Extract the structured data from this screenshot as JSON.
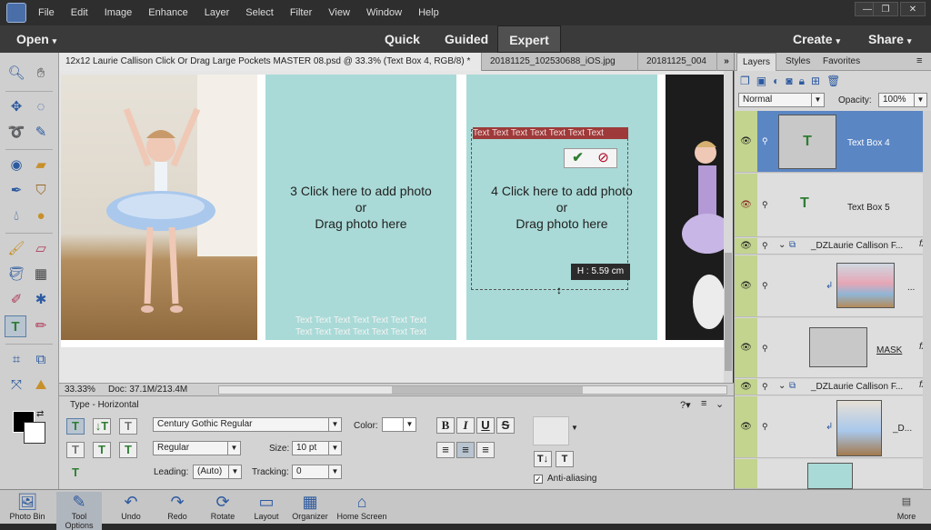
{
  "menu": [
    "File",
    "Edit",
    "Image",
    "Enhance",
    "Layer",
    "Select",
    "Filter",
    "View",
    "Window",
    "Help"
  ],
  "window_buttons": [
    "—",
    "❐",
    "✕"
  ],
  "modes": {
    "open": "Open",
    "quick": "Quick",
    "guided": "Guided",
    "expert": "Expert",
    "create": "Create",
    "share": "Share"
  },
  "tabs": [
    "12x12 Laurie Callison Click Or Drag Large Pockets MASTER 08.psd @ 33.3% (Text Box 4, RGB/8) *",
    "20181125_102530688_iOS.jpg",
    "20181125_004"
  ],
  "canvas": {
    "panel3": {
      "line1": "3 Click here to add photo",
      "line2": "or",
      "line3": "Drag photo here"
    },
    "panel4": {
      "line1": "4 Click here to add photo",
      "line2": "or",
      "line3": "Drag photo here"
    },
    "textbox_text": "Text Text Text Text Text Text Text",
    "footer_text1": "Text Text Text Text Text Text Text",
    "footer_text2": "Text Text Text Text Text Text Text",
    "height_badge": "H : 5.59 cm"
  },
  "status": {
    "zoom": "33.33%",
    "doc": "Doc: 37.1M/213.4M"
  },
  "options": {
    "title": "Type - Horizontal",
    "font": "Century Gothic Regular",
    "style": "Regular",
    "size_label": "Size:",
    "size": "10 pt",
    "leading_label": "Leading:",
    "leading": "(Auto)",
    "tracking_label": "Tracking:",
    "tracking": "0",
    "color_label": "Color:",
    "bold": "B",
    "italic": "I",
    "underline": "U",
    "strike": "S",
    "antialias": "Anti-aliasing"
  },
  "bottom": [
    "Photo Bin",
    "Tool Options",
    "Undo",
    "Redo",
    "Rotate",
    "Layout",
    "Organizer",
    "Home Screen",
    "More"
  ],
  "layers_panel": {
    "tabs": [
      "Layers",
      "Styles",
      "Favorites"
    ],
    "blend": "Normal",
    "opacity_label": "Opacity:",
    "opacity": "100%",
    "rows": [
      "Text Box 4",
      "Text Box 5",
      "_DZLaurie Callison F...",
      "...",
      "MASK",
      "_DZLaurie Callison F...",
      "_D..."
    ]
  },
  "colors": {
    "panel": "#a9dad7",
    "accent": "#4f7fc0"
  }
}
